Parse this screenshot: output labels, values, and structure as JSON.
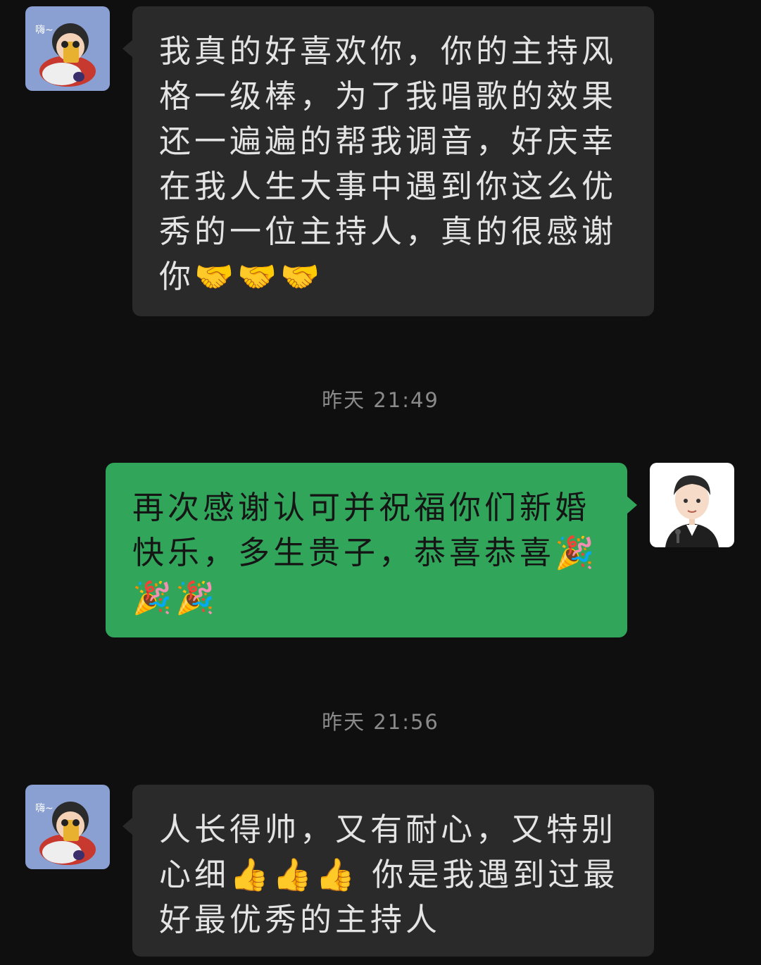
{
  "messages": [
    {
      "sender": "contact",
      "text": "我真的好喜欢你，你的主持风格一级棒，为了我唱歌的效果还一遍遍的帮我调音，好庆幸在我人生大事中遇到你这么优秀的一位主持人，真的很感谢你🤝🤝🤝"
    },
    {
      "sender": "me",
      "text": "再次感谢认可并祝福你们新婚快乐，多生贵子，恭喜恭喜🎉🎉🎉"
    },
    {
      "sender": "contact",
      "text": "人长得帅，又有耐心，又特别心细👍👍👍 你是我遇到过最好最优秀的主持人"
    }
  ],
  "timestamps": [
    "昨天 21:49",
    "昨天 21:56"
  ],
  "contact_avatar": {
    "badge_text": "嗨~",
    "icon": "cartoon-girl-avatar"
  },
  "my_avatar": {
    "icon": "cartoon-host-avatar"
  },
  "colors": {
    "background": "#0f0f0f",
    "incoming_bubble": "#2a2a2a",
    "outgoing_bubble": "#31a65b",
    "timestamp": "#8a8a8a"
  }
}
